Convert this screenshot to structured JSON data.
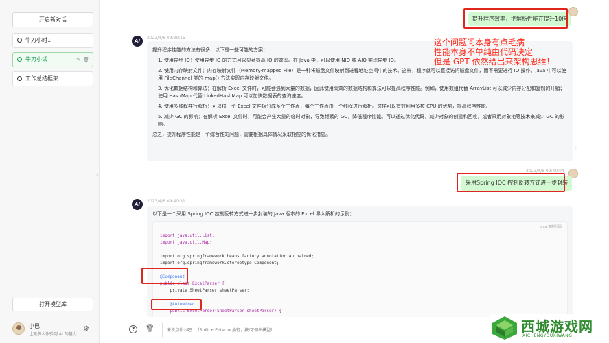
{
  "sidebar": {
    "new_chat": "开启新对话",
    "conversations": [
      {
        "label": "牛刀小时1"
      },
      {
        "label": "牛刀小试"
      },
      {
        "label": "工作总结框架"
      }
    ],
    "open_model_lib": "打开模型库",
    "user": {
      "name": "小巴",
      "description": "让更多人体验到 AI 的魅力"
    }
  },
  "chat": {
    "msg1": {
      "user_text": "提升程序效率，把解析性能在提升10倍",
      "ai_timestamp": "2023/4/6 09:39:15",
      "ai_intro": "提升程序性能的方法有很多，以下是一些可能的方案：",
      "ai_points": [
        "1. 使用异步 IO：使用异步 IO 的方式可以显著提高 IO 的效率。在 Java 中，可以使用 NIO 或 AIO 实现异步 IO。",
        "2. 使用内存映射文件：内存映射文件（Memory-mapped File）是一种将磁盘文件映射到进程地址空间中的技术。这样，程序就可以直接访问磁盘文件，而不需要进行 IO 操作。Java 中可以使用 FileChannel 类的 map() 方法实现内存映射文件。",
        "3. 优化数据结构和算法：在解析 Excel 文件时，可能会遇到大量的数据，因此使用高效的数据结构和算法可以提高程序性能。例如，使用数组代替 ArrayList 可以减少内存分配和复制的开销；使用 HashMap 代替 LinkedHashMap 可以加快数据表的查询速度。",
        "4. 使用多线程并行解析：可以将一个 Excel 文件拆分成多个工作表，每个工作表由一个线程进行解析。这样可以有效利用多核 CPU 的优势，提高程序性能。",
        "5. 减少 GC 的影响：在解析 Excel 文件时，可能会产生大量的临时对象，导致频繁的 GC，降低程序性能。可以通过优化代码，减少对象的创建和回收，或者采用对象池等技术来减少 GC 的影响。"
      ],
      "ai_summary": "总之，提升程序性能是一个综合性的问题，需要根据具体情况采取相应的优化措施。"
    },
    "msg2": {
      "user_timestamp": "2023/4/6 09:40:04",
      "user_text": "采用Spring IOC 控制反转方式进一步封装",
      "ai_timestamp": "2023/4/6 09:40:31",
      "ai_intro": "以下是一个采用 Spring IOC 控制反转方式进一步封装的 Java 版本的 Excel 导入解析的示例：",
      "code_lang": "java",
      "code_copy": "复制代码",
      "code_lines": [
        "import java.util.List;",
        "import java.util.Map;",
        "",
        "import org.springframework.beans.factory.annotation.Autowired;",
        "import org.springframework.stereotype.Component;",
        "",
        "@Component",
        "public class ExcelParser {",
        "    private SheetParser sheetParser;",
        "",
        "    @Autowired",
        "    public ExcelParser(SheetParser sheetParser) {"
      ]
    }
  },
  "annotation": {
    "lines": [
      "这个问题问本身有点毛病",
      "性能本身不单纯由代码决定",
      "但是 GPT 依然给出来架构思维！"
    ],
    "color": "#ff2a1a"
  },
  "input": {
    "placeholder": "来说点什么吧...（Shift + Enter = 换行，按/可调出模型）"
  },
  "watermark": {
    "text": "西城游戏网",
    "sub": "XICHENGYOUXIWANG"
  },
  "colors": {
    "accent": "#18a058",
    "user_bubble": "#d2f9d1",
    "annotation_red": "#e0261c"
  }
}
